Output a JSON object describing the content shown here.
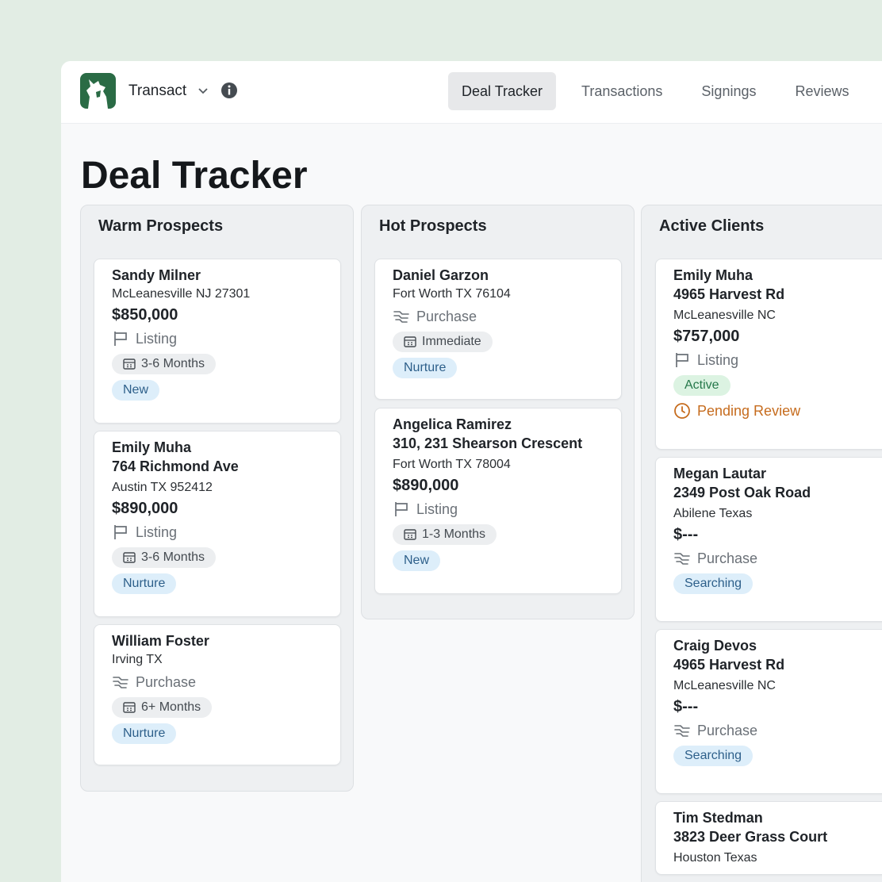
{
  "app": {
    "name": "Transact"
  },
  "nav": {
    "tabs": [
      {
        "label": "Deal Tracker",
        "active": true
      },
      {
        "label": "Transactions",
        "active": false
      },
      {
        "label": "Signings",
        "active": false
      },
      {
        "label": "Reviews",
        "active": false
      }
    ]
  },
  "page": {
    "title": "Deal Tracker"
  },
  "columns": [
    {
      "title": "Warm Prospects",
      "cards": [
        {
          "name": "Sandy Milner",
          "city": "McLeanesville NJ 27301",
          "price": "$850,000",
          "type": "Listing",
          "timeframe": "3-6 Months",
          "status": "New"
        },
        {
          "name": "Emily Muha",
          "address": "764 Richmond Ave",
          "city": "Austin TX 952412",
          "price": "$890,000",
          "type": "Listing",
          "timeframe": "3-6 Months",
          "status": "Nurture"
        },
        {
          "name": "William Foster",
          "city": "Irving TX",
          "type": "Purchase",
          "timeframe": "6+ Months",
          "status": "Nurture"
        }
      ]
    },
    {
      "title": "Hot Prospects",
      "cards": [
        {
          "name": "Daniel Garzon",
          "city": "Fort Worth TX 76104",
          "type": "Purchase",
          "timeframe": "Immediate",
          "status": "Nurture"
        },
        {
          "name": "Angelica Ramirez",
          "address": "310, 231 Shearson Crescent",
          "city": "Fort Worth TX 78004",
          "price": "$890,000",
          "type": "Listing",
          "timeframe": "1-3 Months",
          "status": "New"
        }
      ]
    },
    {
      "title": "Active Clients",
      "cards": [
        {
          "name": "Emily Muha",
          "address": "4965 Harvest Rd",
          "city": "McLeanesville NC",
          "price": "$757,000",
          "type": "Listing",
          "status": "Active",
          "review": "Pending Review"
        },
        {
          "name": "Megan Lautar",
          "address": "2349 Post Oak Road",
          "city": "Abilene Texas",
          "price": "$---",
          "type": "Purchase",
          "status": "Searching"
        },
        {
          "name": "Craig Devos",
          "address": "4965 Harvest Rd",
          "city": "McLeanesville NC",
          "price": "$---",
          "type": "Purchase",
          "status": "Searching"
        },
        {
          "name": "Tim Stedman",
          "address": "3823 Deer Grass Court",
          "city": "Houston Texas"
        }
      ]
    }
  ],
  "colors": {
    "background": "#e2ede4",
    "brand_green": "#2a6b45",
    "pill_blue_bg": "#ddeefa",
    "pill_green_bg": "#dcf3e2",
    "pending_orange": "#c66c1e"
  },
  "icons": {
    "listing": "flag-icon",
    "purchase": "handshake-icon",
    "timeframe": "calendar-icon",
    "pending": "clock-icon",
    "info": "info-icon",
    "chevron": "chevron-down-icon"
  }
}
